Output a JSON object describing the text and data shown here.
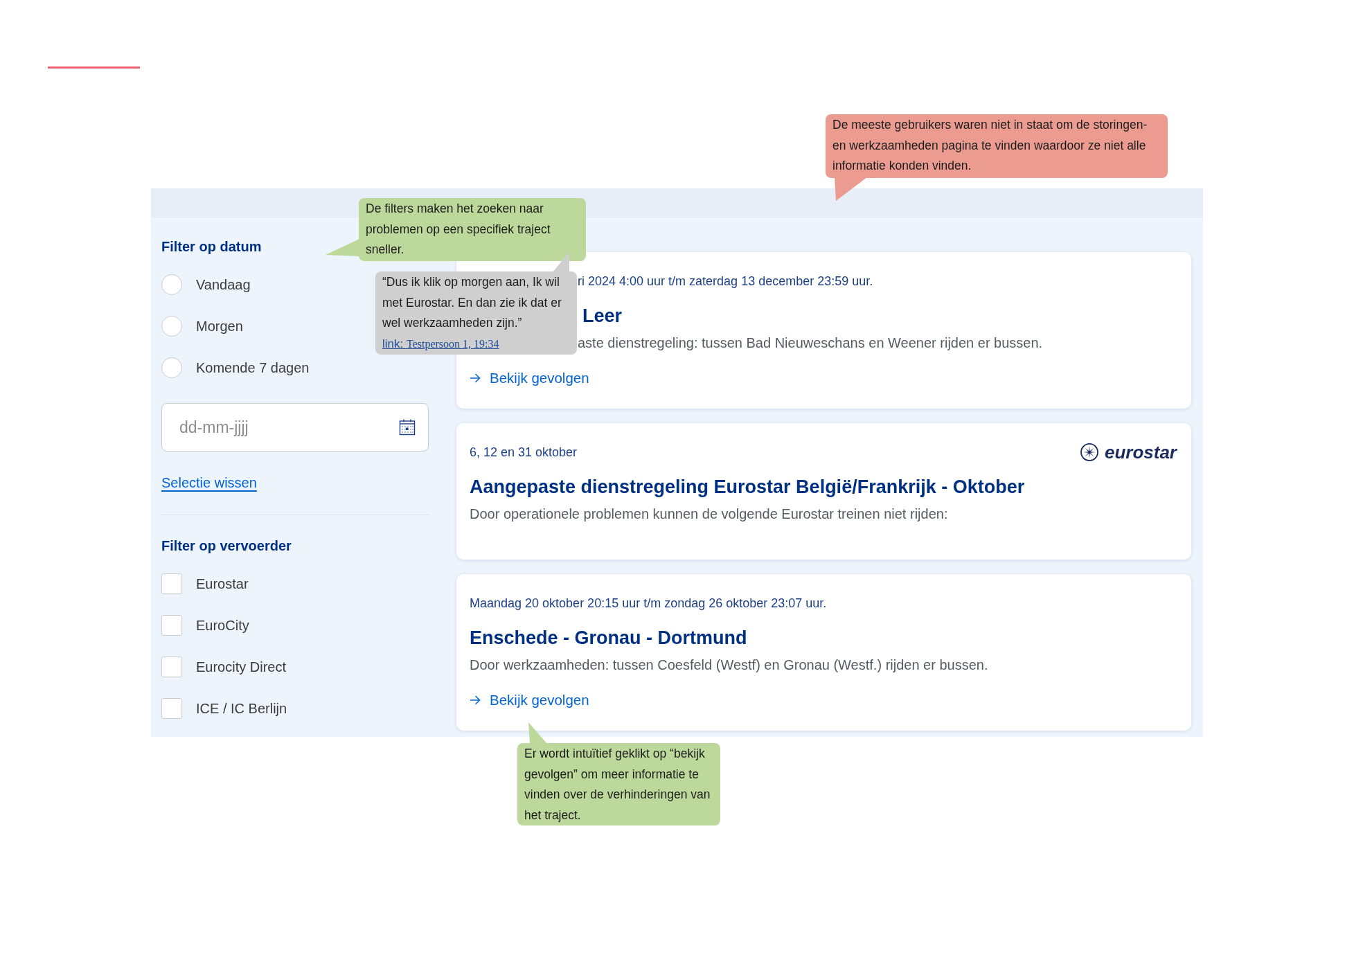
{
  "annotations": [
    {
      "kind": "note",
      "color": "#eb9b90",
      "text": "De meeste gebruikers waren niet in staat om de storingen- en werkzaamheden pagina te vinden waardoor ze niet alle informatie konden vinden."
    },
    {
      "kind": "note",
      "color": "#bcd89a",
      "text": "De filters maken het zoeken naar problemen op een specifiek traject sneller."
    },
    {
      "kind": "quote",
      "color": "#cfcfcf",
      "text": "“Dus ik klik op morgen aan, Ik wil met Eurostar. En dan zie ik dat er wel werkzaamheden zijn.”",
      "source": {
        "label": "link:",
        "reference": "Testpersoon 1, 19:34"
      }
    },
    {
      "kind": "note",
      "color": "#bcd89a",
      "text": "Er wordt intuïtief geklikt op “bekijk gevolgen” om meer informatie te vinden over de verhinderingen van het traject."
    }
  ],
  "page": {
    "date_filter": {
      "heading": "Filter op datum",
      "options": [
        {
          "label": "Vandaag",
          "selected": false
        },
        {
          "label": "Morgen",
          "selected": false
        },
        {
          "label": "Komende 7 dagen",
          "selected": false
        }
      ],
      "date_field": {
        "placeholder": "dd-mm-jjjj"
      },
      "clear_link": "Selectie wissen"
    },
    "carrier_filter": {
      "heading": "Filter op vervoerder",
      "options": [
        {
          "label": "Eurostar",
          "checked": false
        },
        {
          "label": "EuroCity",
          "checked": false
        },
        {
          "label": "Eurocity Direct",
          "checked": false
        },
        {
          "label": "ICE / IC Berlijn",
          "checked": false
        }
      ]
    },
    "cards": [
      {
        "date": "ri 2024 4:00 uur t/m zaterdag 13 december 23:59 uur.",
        "title": "Leer",
        "description": "aste dienstregeling: tussen Bad Nieuweschans en Weener rijden er bussen.",
        "link": "Bekijk gevolgen"
      },
      {
        "date": "6, 12 en 31 oktober",
        "logo": "eurostar",
        "title": "Aangepaste dienstregeling Eurostar België/Frankrijk - Oktober",
        "description": "Door operationele problemen kunnen de volgende Eurostar treinen niet rijden:"
      },
      {
        "date": "Maandag 20 oktober 20:15 uur t/m zondag 26 oktober 23:07 uur.",
        "title": "Enschede - Gronau - Dortmund",
        "description": "Door werkzaamheden: tussen Coesfeld (Westf) en Gronau (Westf.) rijden er bussen.",
        "link": "Bekijk gevolgen"
      }
    ]
  }
}
